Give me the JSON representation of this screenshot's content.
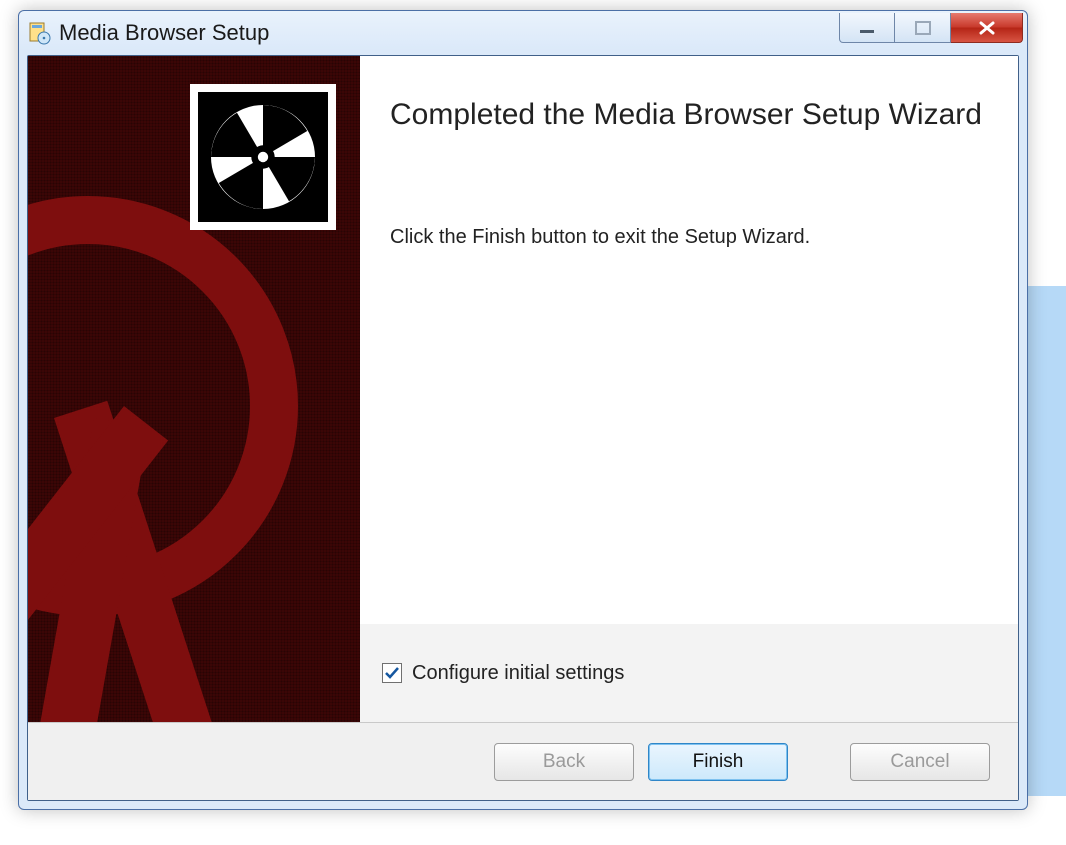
{
  "window": {
    "title": "Media Browser Setup"
  },
  "wizard": {
    "heading": "Completed the Media Browser Setup Wizard",
    "description": "Click the Finish button to exit the Setup Wizard.",
    "option": {
      "label": "Configure initial settings",
      "checked": true
    }
  },
  "buttons": {
    "back": "Back",
    "finish": "Finish",
    "cancel": "Cancel",
    "back_enabled": false,
    "cancel_enabled": false
  }
}
